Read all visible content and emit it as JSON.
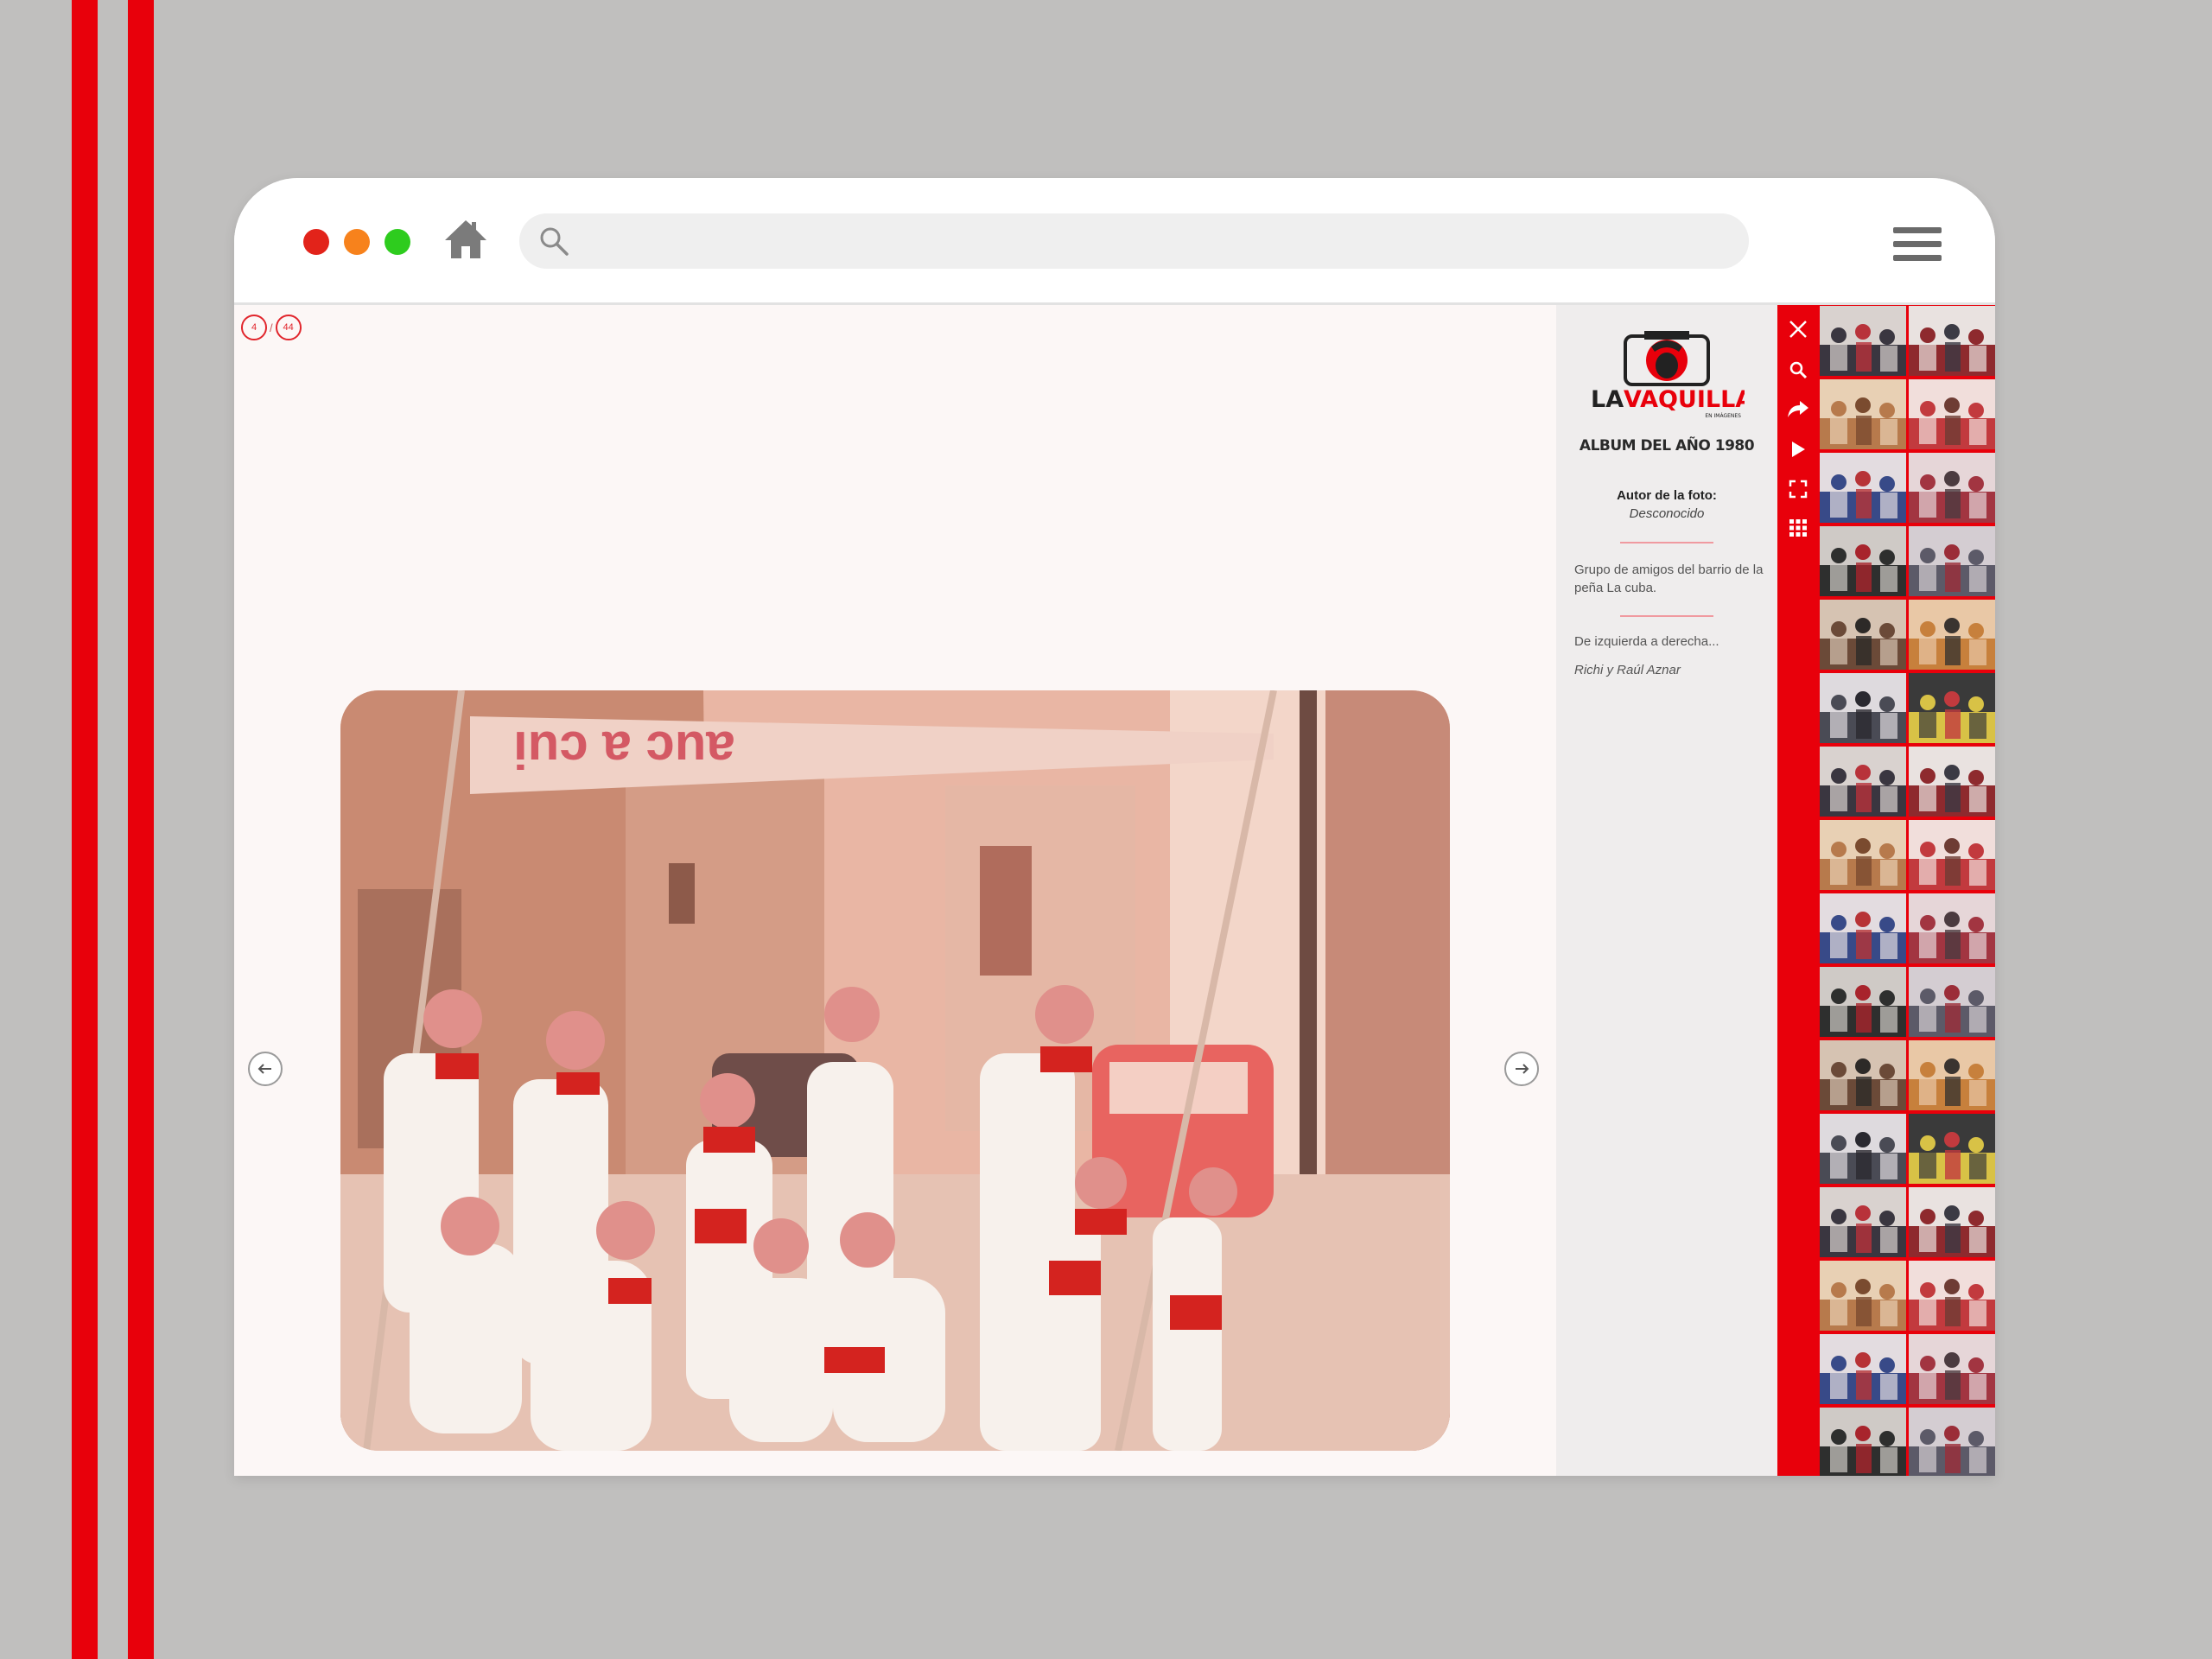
{
  "browser": {
    "search_placeholder": "",
    "icons": [
      "home-icon",
      "search-icon",
      "menu-icon"
    ]
  },
  "viewer": {
    "current_index": "4",
    "separator": "/",
    "total": "44",
    "photo_description": "Grupo de niños con pañuelos rojos sujetando una pancarta en una calle"
  },
  "info": {
    "logo_part1": "LA",
    "logo_part2": "VAQUILLA",
    "logo_tagline": "EN IMÁGENES",
    "album_title": "ALBUM DEL AÑO 1980",
    "author_label": "Autor de la foto:",
    "author_name": "Desconocido",
    "description": "Grupo de amigos del barrio de la peña La cuba.",
    "left_to_right_label": "De izquierda a derecha...",
    "people": "Richi y Raúl Aznar"
  },
  "toolbar": {
    "tools": [
      "close-icon",
      "zoom-icon",
      "share-icon",
      "play-icon",
      "fullscreen-icon",
      "grid-icon"
    ]
  },
  "colors": {
    "accent": "#e8000b",
    "background": "#c0bfbe",
    "viewer_bg": "#fcf7f6",
    "info_bg": "#efeded"
  },
  "thumbnails": {
    "count": 32,
    "active_index": 3
  }
}
